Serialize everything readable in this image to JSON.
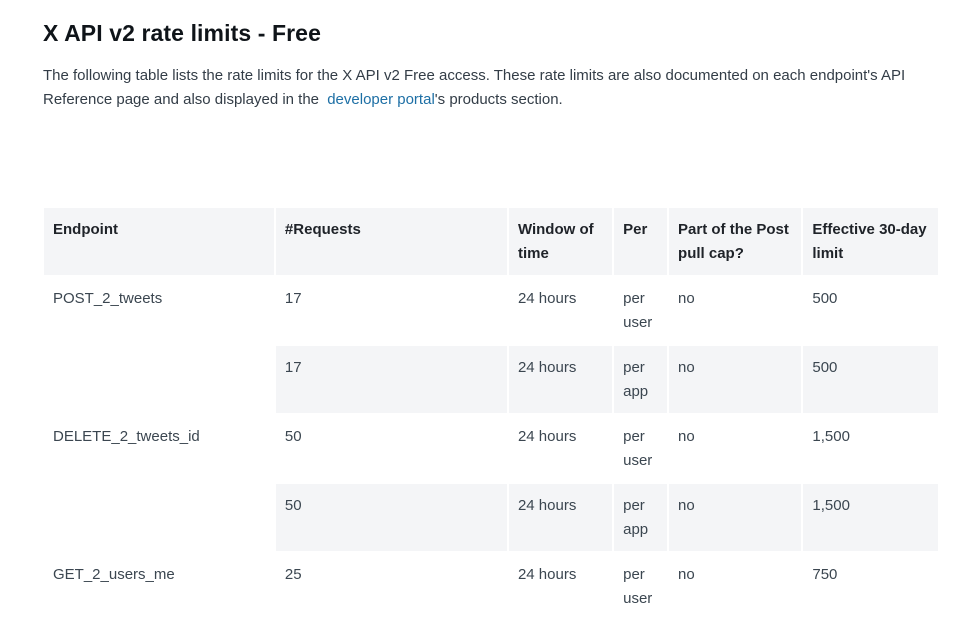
{
  "title": "X API v2 rate limits - Free",
  "intro": {
    "text_before": "The following table lists the rate limits for the X API v2 Free access. These rate limits are also documented on each endpoint's API Reference page and also displayed in the ",
    "link_text": "developer portal",
    "text_after": "'s products section."
  },
  "table": {
    "headers": [
      "Endpoint",
      "#Requests",
      "Window of time",
      "Per",
      "Part of the Post pull cap?",
      "Effective 30-day limit"
    ],
    "rows": [
      {
        "endpoint": "POST_2_tweets",
        "requests": "17",
        "window": "24 hours",
        "per": "per user",
        "cap": "no",
        "effective": "500"
      },
      {
        "endpoint": "",
        "requests": "17",
        "window": "24 hours",
        "per": "per app",
        "cap": "no",
        "effective": "500"
      },
      {
        "endpoint": "DELETE_2_tweets_id",
        "requests": "50",
        "window": "24 hours",
        "per": "per user",
        "cap": "no",
        "effective": "1,500"
      },
      {
        "endpoint": "",
        "requests": "50",
        "window": "24 hours",
        "per": "per app",
        "cap": "no",
        "effective": "1,500"
      },
      {
        "endpoint": "GET_2_users_me",
        "requests": "25",
        "window": "24 hours",
        "per": "per user",
        "cap": "no",
        "effective": "750"
      }
    ]
  }
}
